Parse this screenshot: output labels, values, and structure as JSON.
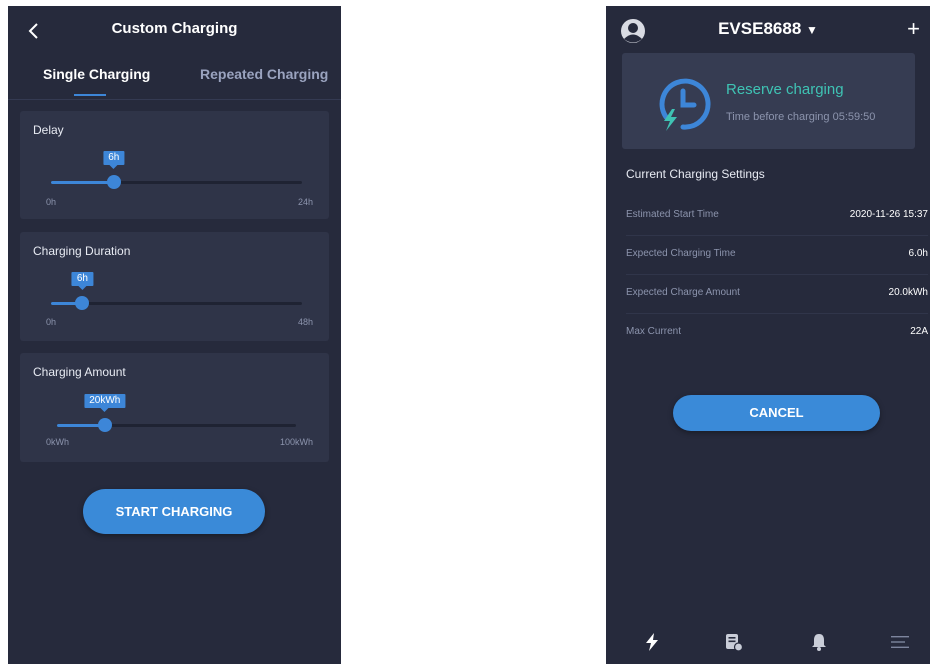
{
  "left": {
    "title": "Custom Charging",
    "tabs": [
      "Single Charging",
      "Repeated Charging"
    ],
    "sliders": [
      {
        "label": "Delay",
        "value": "6h",
        "min": "0h",
        "max": "24h",
        "fraction": 0.25
      },
      {
        "label": "Charging Duration",
        "value": "6h",
        "min": "0h",
        "max": "48h",
        "fraction": 0.125
      },
      {
        "label": "Charging Amount",
        "value": "20kWh",
        "min": "0kWh",
        "max": "100kWh",
        "fraction": 0.2
      }
    ],
    "start_button": "START CHARGING"
  },
  "right": {
    "device": "EVSE8688",
    "reserve_title": "Reserve charging",
    "reserve_subtitle": "Time before charging 05:59:50",
    "section_title": "Current Charging Settings",
    "settings": [
      {
        "key": "Estimated Start Time",
        "value": "2020-11-26 15:37"
      },
      {
        "key": "Expected Charging Time",
        "value": "6.0h"
      },
      {
        "key": "Expected Charge Amount",
        "value": "20.0kWh"
      },
      {
        "key": "Max Current",
        "value": "22A"
      }
    ],
    "cancel_button": "CANCEL",
    "nav_icons": [
      "lightning-icon",
      "document-icon",
      "bell-icon",
      "menu-icon"
    ]
  },
  "colors": {
    "background": "#262a3c",
    "card": "#2f3448",
    "accent": "#3d86d8",
    "teal": "#3fc3b4"
  }
}
